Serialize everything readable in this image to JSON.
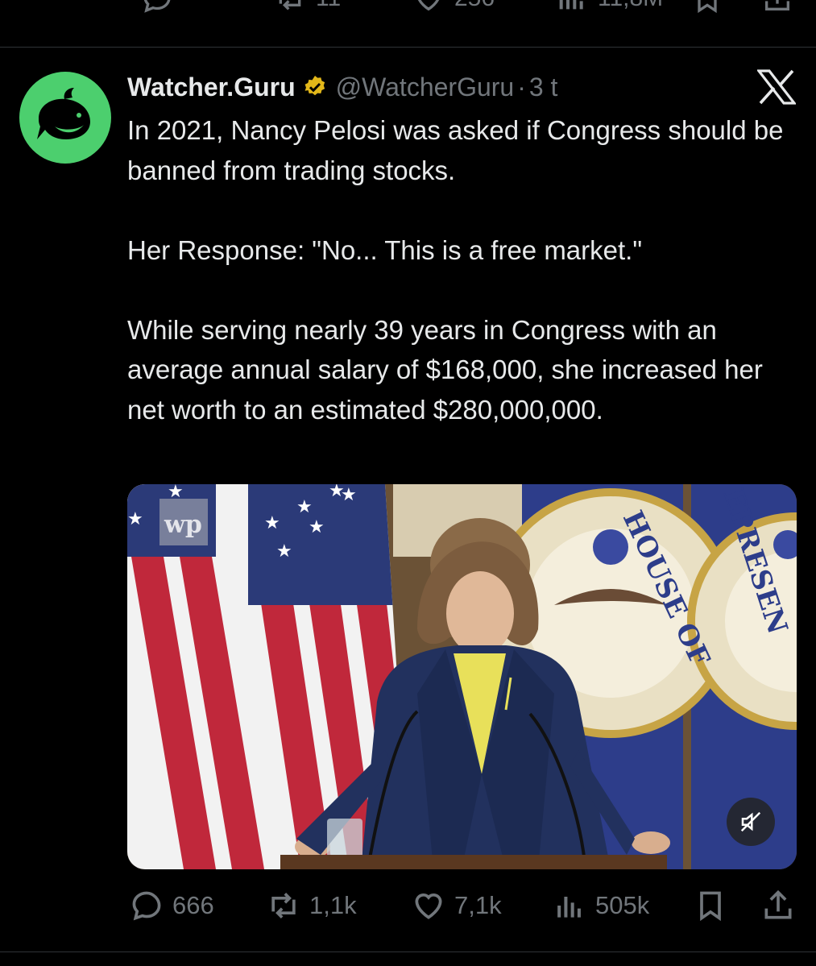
{
  "previous_tweet": {
    "retweets": "11",
    "likes": "256",
    "views": "11,8M"
  },
  "tweet": {
    "author_name": "Watcher.Guru",
    "handle": "@WatcherGuru",
    "separator": "·",
    "time": "3 t",
    "paragraphs": [
      "In 2021, Nancy Pelosi was asked if Congress should be banned from trading stocks.",
      "Her Response: \"No... This is a free market.\"",
      "While serving nearly 39 years in Congress with an average annual salary of $168,000, she increased her net worth to an estimated $280,000,000."
    ],
    "media_text": {
      "watermark": "wp",
      "seal_left": "HOUSE OF",
      "seal_right": "EPRESEN"
    },
    "metrics": {
      "replies": "666",
      "retweets": "1,1k",
      "likes": "7,1k",
      "views": "505k"
    }
  },
  "colors": {
    "background": "#000000",
    "text": "#e7e9ea",
    "muted": "#71767b",
    "avatar": "#4ccf6e",
    "verified_badge": "#e2b719",
    "divider": "#2f3336"
  },
  "icons": [
    "reply-icon",
    "retweet-icon",
    "like-icon",
    "views-icon",
    "bookmark-icon",
    "share-icon",
    "verified-icon",
    "x-logo-icon",
    "mute-icon"
  ]
}
